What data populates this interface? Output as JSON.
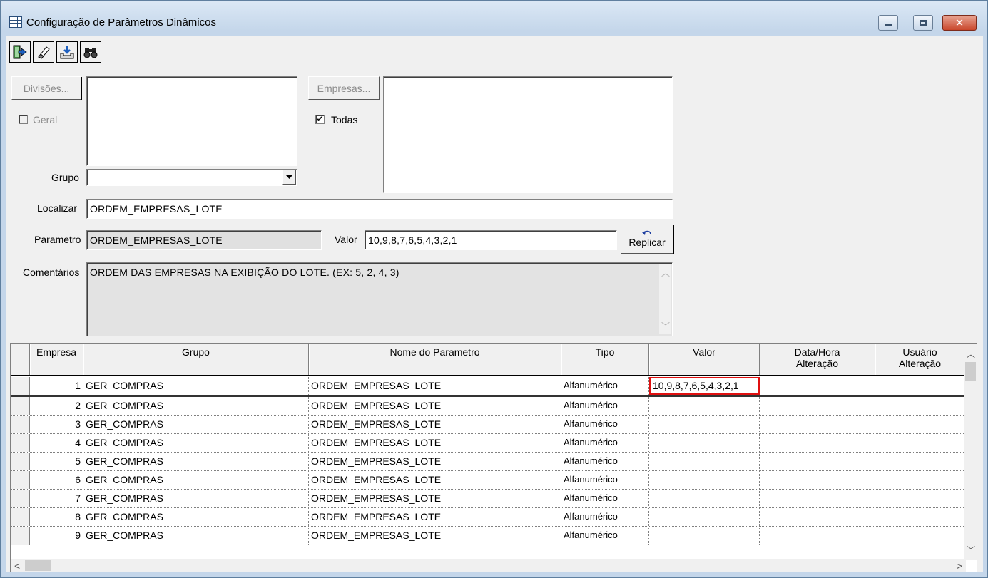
{
  "window": {
    "title": "Configuração de Parâmetros Dinâmicos",
    "controls": {
      "minimize": "minimize",
      "maximize": "maximize",
      "close": "✕"
    }
  },
  "toolbar": {
    "buttons": [
      {
        "name": "exit",
        "icon": "exit-door-icon"
      },
      {
        "name": "clear",
        "icon": "eraser-icon"
      },
      {
        "name": "save",
        "icon": "save-tray-icon"
      },
      {
        "name": "search",
        "icon": "binoculars-icon"
      }
    ]
  },
  "filters": {
    "divisoes_button": "Divisões...",
    "geral_label": "Geral",
    "geral_checked": false,
    "empresas_button": "Empresas...",
    "todas_label": "Todas",
    "todas_checked": true,
    "grupo_label": "Grupo",
    "grupo_value": "",
    "localizar_label": "Localizar",
    "localizar_value": "ORDEM_EMPRESAS_LOTE"
  },
  "details": {
    "parametro_label": "Parametro",
    "parametro_value": "ORDEM_EMPRESAS_LOTE",
    "valor_label": "Valor",
    "valor_value": "10,9,8,7,6,5,4,3,2,1",
    "replicar_label": "Replicar",
    "comentarios_label": "Comentários",
    "comentarios_value": "ORDEM DAS EMPRESAS NA EXIBIÇÃO DO LOTE. (EX: 5, 2, 4, 3)"
  },
  "grid": {
    "columns": [
      "Empresa",
      "Grupo",
      "Nome do Parametro",
      "Tipo",
      "Valor",
      "Data/Hora\nAlteração",
      "Usuário\nAlteração"
    ],
    "rows": [
      {
        "empresa": "1",
        "grupo": "GER_COMPRAS",
        "nome": "ORDEM_EMPRESAS_LOTE",
        "tipo": "Alfanumérico",
        "valor": "10,9,8,7,6,5,4,3,2,1",
        "data": "",
        "usuario": ""
      },
      {
        "empresa": "2",
        "grupo": "GER_COMPRAS",
        "nome": "ORDEM_EMPRESAS_LOTE",
        "tipo": "Alfanumérico",
        "valor": "",
        "data": "",
        "usuario": ""
      },
      {
        "empresa": "3",
        "grupo": "GER_COMPRAS",
        "nome": "ORDEM_EMPRESAS_LOTE",
        "tipo": "Alfanumérico",
        "valor": "",
        "data": "",
        "usuario": ""
      },
      {
        "empresa": "4",
        "grupo": "GER_COMPRAS",
        "nome": "ORDEM_EMPRESAS_LOTE",
        "tipo": "Alfanumérico",
        "valor": "",
        "data": "",
        "usuario": ""
      },
      {
        "empresa": "5",
        "grupo": "GER_COMPRAS",
        "nome": "ORDEM_EMPRESAS_LOTE",
        "tipo": "Alfanumérico",
        "valor": "",
        "data": "",
        "usuario": ""
      },
      {
        "empresa": "6",
        "grupo": "GER_COMPRAS",
        "nome": "ORDEM_EMPRESAS_LOTE",
        "tipo": "Alfanumérico",
        "valor": "",
        "data": "",
        "usuario": ""
      },
      {
        "empresa": "7",
        "grupo": "GER_COMPRAS",
        "nome": "ORDEM_EMPRESAS_LOTE",
        "tipo": "Alfanumérico",
        "valor": "",
        "data": "",
        "usuario": ""
      },
      {
        "empresa": "8",
        "grupo": "GER_COMPRAS",
        "nome": "ORDEM_EMPRESAS_LOTE",
        "tipo": "Alfanumérico",
        "valor": "",
        "data": "",
        "usuario": ""
      },
      {
        "empresa": "9",
        "grupo": "GER_COMPRAS",
        "nome": "ORDEM_EMPRESAS_LOTE",
        "tipo": "Alfanumérico",
        "valor": "",
        "data": "",
        "usuario": ""
      }
    ],
    "highlight_color": "#e01010"
  }
}
